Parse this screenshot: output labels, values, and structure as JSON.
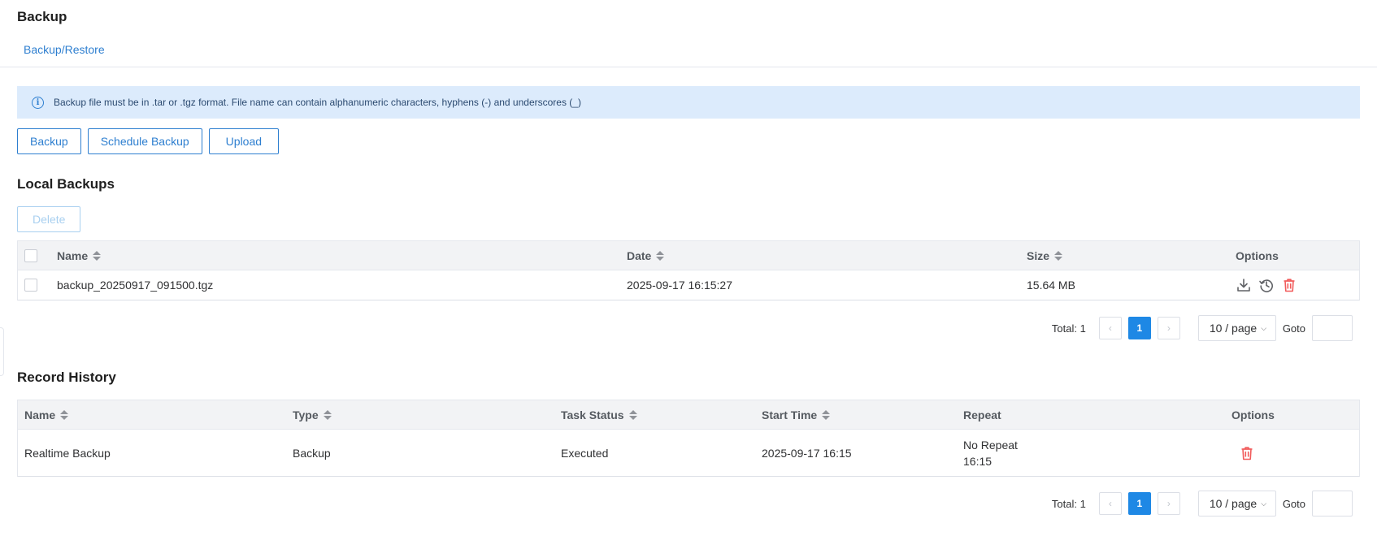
{
  "page": {
    "title": "Backup"
  },
  "tabs": [
    {
      "label": "Backup/Restore"
    }
  ],
  "notice": {
    "icon": "info-icon",
    "text": "Backup file must be in .tar or .tgz format. File name can contain alphanumeric characters, hyphens (-) and underscores (_)"
  },
  "toolbar": {
    "backup_label": "Backup",
    "schedule_label": "Schedule Backup",
    "upload_label": "Upload"
  },
  "local_backups": {
    "title": "Local Backups",
    "delete_label": "Delete",
    "columns": {
      "name": "Name",
      "date": "Date",
      "size": "Size",
      "options": "Options"
    },
    "rows": [
      {
        "name": "backup_20250917_091500.tgz",
        "date": "2025-09-17 16:15:27",
        "size": "15.64 MB",
        "options": [
          "download-icon",
          "restore-icon",
          "delete-icon"
        ]
      }
    ],
    "pagination": {
      "total": "Total: 1",
      "prev": "‹",
      "page": "1",
      "next": "›",
      "page_size": "10 / page",
      "goto": "Goto"
    }
  },
  "record_history": {
    "title": "Record History",
    "columns": {
      "name": "Name",
      "type": "Type",
      "task_status": "Task Status",
      "start_time": "Start Time",
      "repeat": "Repeat",
      "options": "Options"
    },
    "rows": [
      {
        "name": "Realtime Backup",
        "type": "Backup",
        "task_status": "Executed",
        "start_time": "2025-09-17 16:15",
        "repeat_line1": "No Repeat",
        "repeat_line2": "16:15",
        "options": [
          "delete-icon"
        ]
      }
    ],
    "pagination": {
      "total": "Total: 1",
      "prev": "‹",
      "page": "1",
      "next": "›",
      "page_size": "10 / page",
      "goto": "Goto"
    }
  },
  "colors": {
    "accent": "#2e7fd0",
    "notice_bg": "#dcebfc",
    "danger": "#f15b5b",
    "active_page": "#1e88e5"
  }
}
